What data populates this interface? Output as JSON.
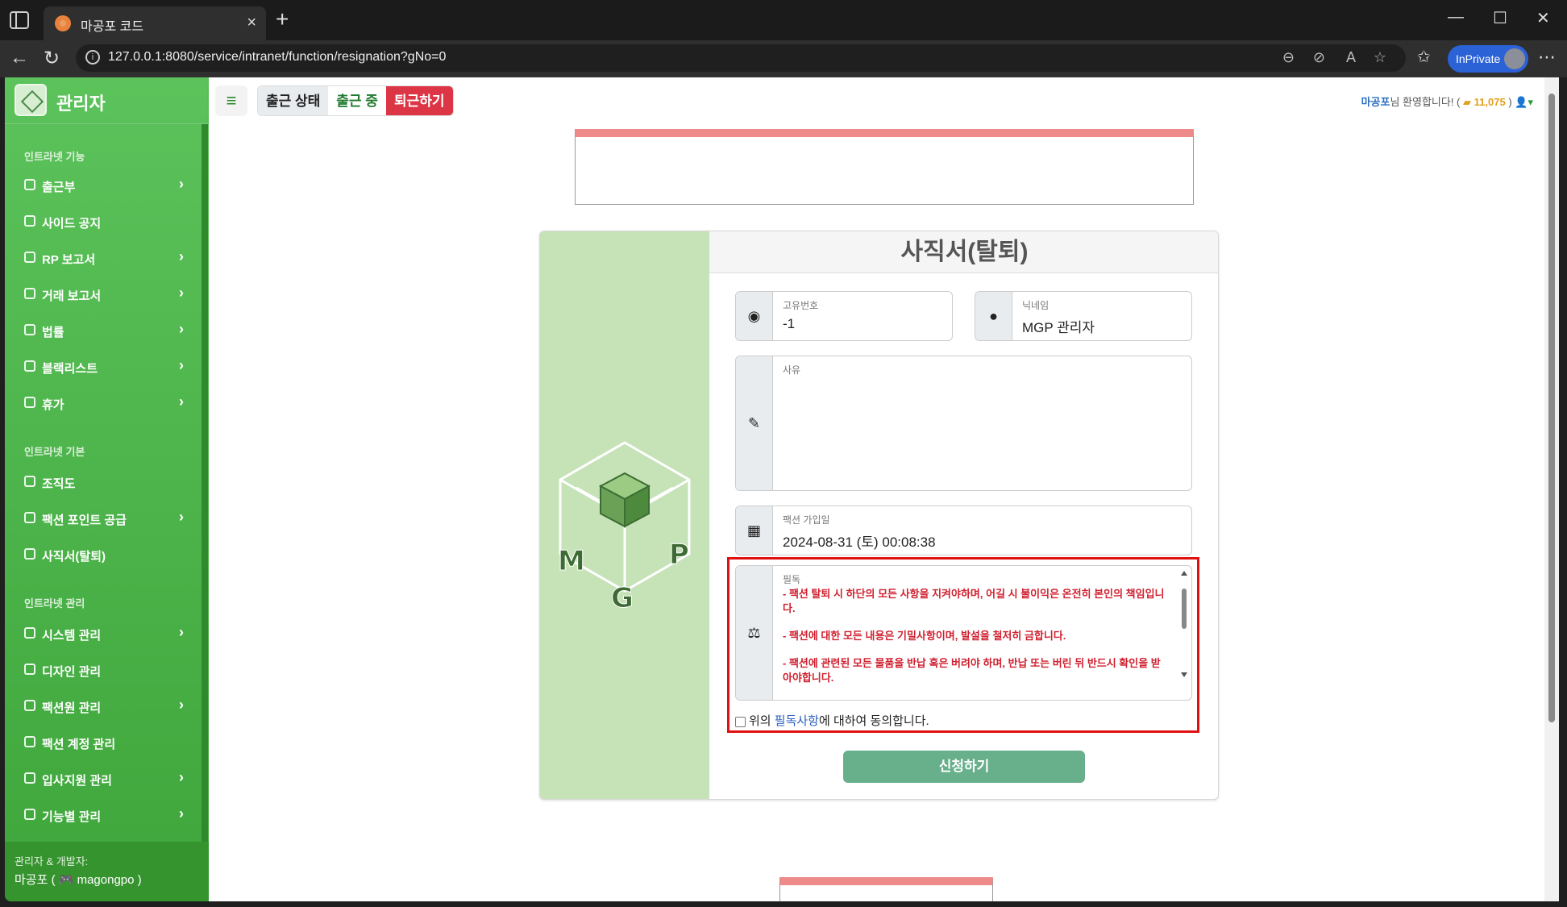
{
  "browser": {
    "tab_title": "마공포 코드",
    "url": "127.0.0.1:8080/service/intranet/function/resignation?gNo=0",
    "inprivate": "InPrivate"
  },
  "sidebar": {
    "brand": "관리자",
    "sections": [
      {
        "label": "인트라넷 기능"
      },
      {
        "label": "인트라넷 기본"
      },
      {
        "label": "인트라넷 관리"
      }
    ],
    "items": [
      {
        "label": "출근부",
        "icon": "book-icon",
        "chevron": true
      },
      {
        "label": "사이드 공지",
        "icon": "megaphone-icon",
        "chevron": false
      },
      {
        "label": "RP 보고서",
        "icon": "gamepad-icon",
        "chevron": true
      },
      {
        "label": "거래 보고서",
        "icon": "flask-icon",
        "chevron": true
      },
      {
        "label": "법률",
        "icon": "scale-icon",
        "chevron": true
      },
      {
        "label": "블랙리스트",
        "icon": "ban-icon",
        "chevron": true
      },
      {
        "label": "휴가",
        "icon": "plane-icon",
        "chevron": true
      },
      {
        "label": "조직도",
        "icon": "sitemap-icon",
        "chevron": false
      },
      {
        "label": "팩션 포인트 공급",
        "icon": "coins-icon",
        "chevron": true
      },
      {
        "label": "사직서(탈퇴)",
        "icon": "signature-icon",
        "chevron": false
      },
      {
        "label": "시스템 관리",
        "icon": "gear-icon",
        "chevron": true
      },
      {
        "label": "디자인 관리",
        "icon": "brush-icon",
        "chevron": false
      },
      {
        "label": "팩션원 관리",
        "icon": "user-gear-icon",
        "chevron": true
      },
      {
        "label": "팩션 계정 관리",
        "icon": "id-card-icon",
        "chevron": false
      },
      {
        "label": "입사지원 관리",
        "icon": "briefcase-icon",
        "chevron": true
      },
      {
        "label": "기능별 관리",
        "icon": "gears-icon",
        "chevron": true
      }
    ],
    "footer_label": "관리자 & 개발자:",
    "footer_name": "마공포 ( 🎮 magongpo )"
  },
  "topbar": {
    "status_label": "출근 상태",
    "status_value": "출근 중",
    "leave_button": "퇴근하기",
    "welcome_user": "마공포",
    "welcome_text": "님 환영합니다! (",
    "points": "11,075",
    "welcome_close": ")"
  },
  "form": {
    "title": "사직서(탈퇴)",
    "id_label": "고유번호",
    "id_value": "-1",
    "nick_label": "닉네임",
    "nick_value": "MGP 관리자",
    "reason_label": "사유",
    "reason_value": "",
    "join_label": "팩션 가입일",
    "join_value": "2024-08-31 (토) 00:08:38",
    "notice_label": "필독",
    "notice_lines": [
      "- 팩션 탈퇴 시 하단의 모든 사항을 지켜야하며, 어길 시 불이익은 온전히 본인의 책임입니다.",
      "- 팩션에 대한 모든 내용은 기밀사항이며, 발설을 철저히 금합니다.",
      "- 팩션에 관련된 모든 물품을 반납 혹은 버려야 하며, 반납 또는 버린 뒤 반드시 확인을 받아야합니다."
    ],
    "agree_prefix": "위의 ",
    "agree_link": "필독사항",
    "agree_suffix": "에 대하여 동의합니다.",
    "submit": "신청하기"
  },
  "colors": {
    "sidebar": "#4cb64a",
    "danger": "#dc3545",
    "submit": "#68b08c",
    "highlight": "#e01010"
  }
}
